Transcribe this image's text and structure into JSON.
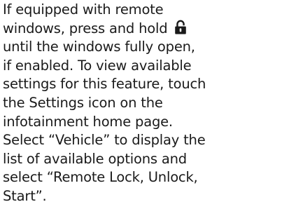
{
  "document": {
    "lines": [
      "If equipped with remote",
      "windows, press and hold",
      "until the windows fully open,",
      "if enabled. To view available",
      "settings for this feature, touch",
      "the Settings icon on the",
      "infotainment home page.",
      "Select “Vehicle” to display the",
      "list of available options and",
      "select “Remote Lock, Unlock,",
      "Start”."
    ],
    "inline_icon": "unlock-icon"
  }
}
